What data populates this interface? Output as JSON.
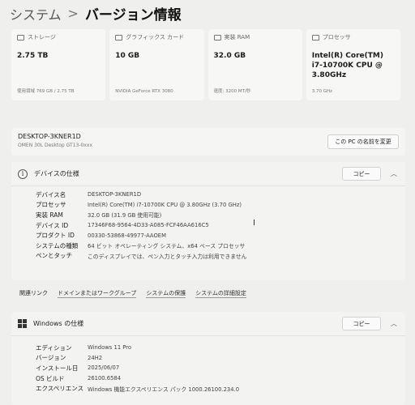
{
  "breadcrumb": {
    "root": "システム",
    "separator": ">",
    "current": "バージョン情報"
  },
  "cards": [
    {
      "label": "ストレージ",
      "value": "2.75 TB",
      "sub": "使用領域 769 GB / 2.75 TB",
      "icon": "storage-icon"
    },
    {
      "label": "グラフィックス カード",
      "value": "10 GB",
      "sub": "NVIDIA GeForce RTX 3080",
      "icon": "graphics-card-icon"
    },
    {
      "label": "実装 RAM",
      "value": "32.0 GB",
      "sub": "速度: 3200 MT/秒",
      "icon": "ram-icon"
    },
    {
      "label": "プロセッサ",
      "value": "Intel(R) Core(TM) i7-10700K CPU @ 3.80GHz",
      "sub": "3.70 GHz",
      "icon": "processor-icon"
    }
  ],
  "device": {
    "name": "DESKTOP-3KNER1D",
    "model": "OMEN 30L Desktop GT13-0xxx",
    "rename_label": "この PC の名前を変更"
  },
  "device_specs": {
    "title": "デバイスの仕様",
    "copy_label": "コピー",
    "rows": [
      {
        "label": "デバイス名",
        "value": "DESKTOP-3KNER1D"
      },
      {
        "label": "プロセッサ",
        "value": "Intel(R) Core(TM) i7-10700K CPU @ 3.80GHz (3.70 GHz)"
      },
      {
        "label": "実装 RAM",
        "value": "32.0 GB (31.9 GB 使用可能)"
      },
      {
        "label": "デバイス ID",
        "value": "17346F68-9564-4D33-A085-FCF46AA616C5"
      },
      {
        "label": "プロダクト ID",
        "value": "00330-53868-49977-AAOEM"
      },
      {
        "label": "システムの種類",
        "value": "64 ビット オペレーティング システム、x64 ベース プロセッサ"
      },
      {
        "label": "ペンとタッチ",
        "value": "このディスプレイでは、ペン入力とタッチ入力は利用できません"
      }
    ]
  },
  "related_links": {
    "heading": "関連リンク",
    "links": [
      "ドメインまたはワークグループ",
      "システムの保護",
      "システムの詳細設定"
    ]
  },
  "windows_specs": {
    "title": "Windows の仕様",
    "copy_label": "コピー",
    "rows": [
      {
        "label": "エディション",
        "value": "Windows 11 Pro"
      },
      {
        "label": "バージョン",
        "value": "24H2"
      },
      {
        "label": "インストール日",
        "value": "2025/06/07"
      },
      {
        "label": "OS ビルド",
        "value": "26100.6584"
      },
      {
        "label": "エクスペリエンス",
        "value": "Windows 機能エクスペリエンス パック 1000.26100.234.0"
      }
    ]
  }
}
